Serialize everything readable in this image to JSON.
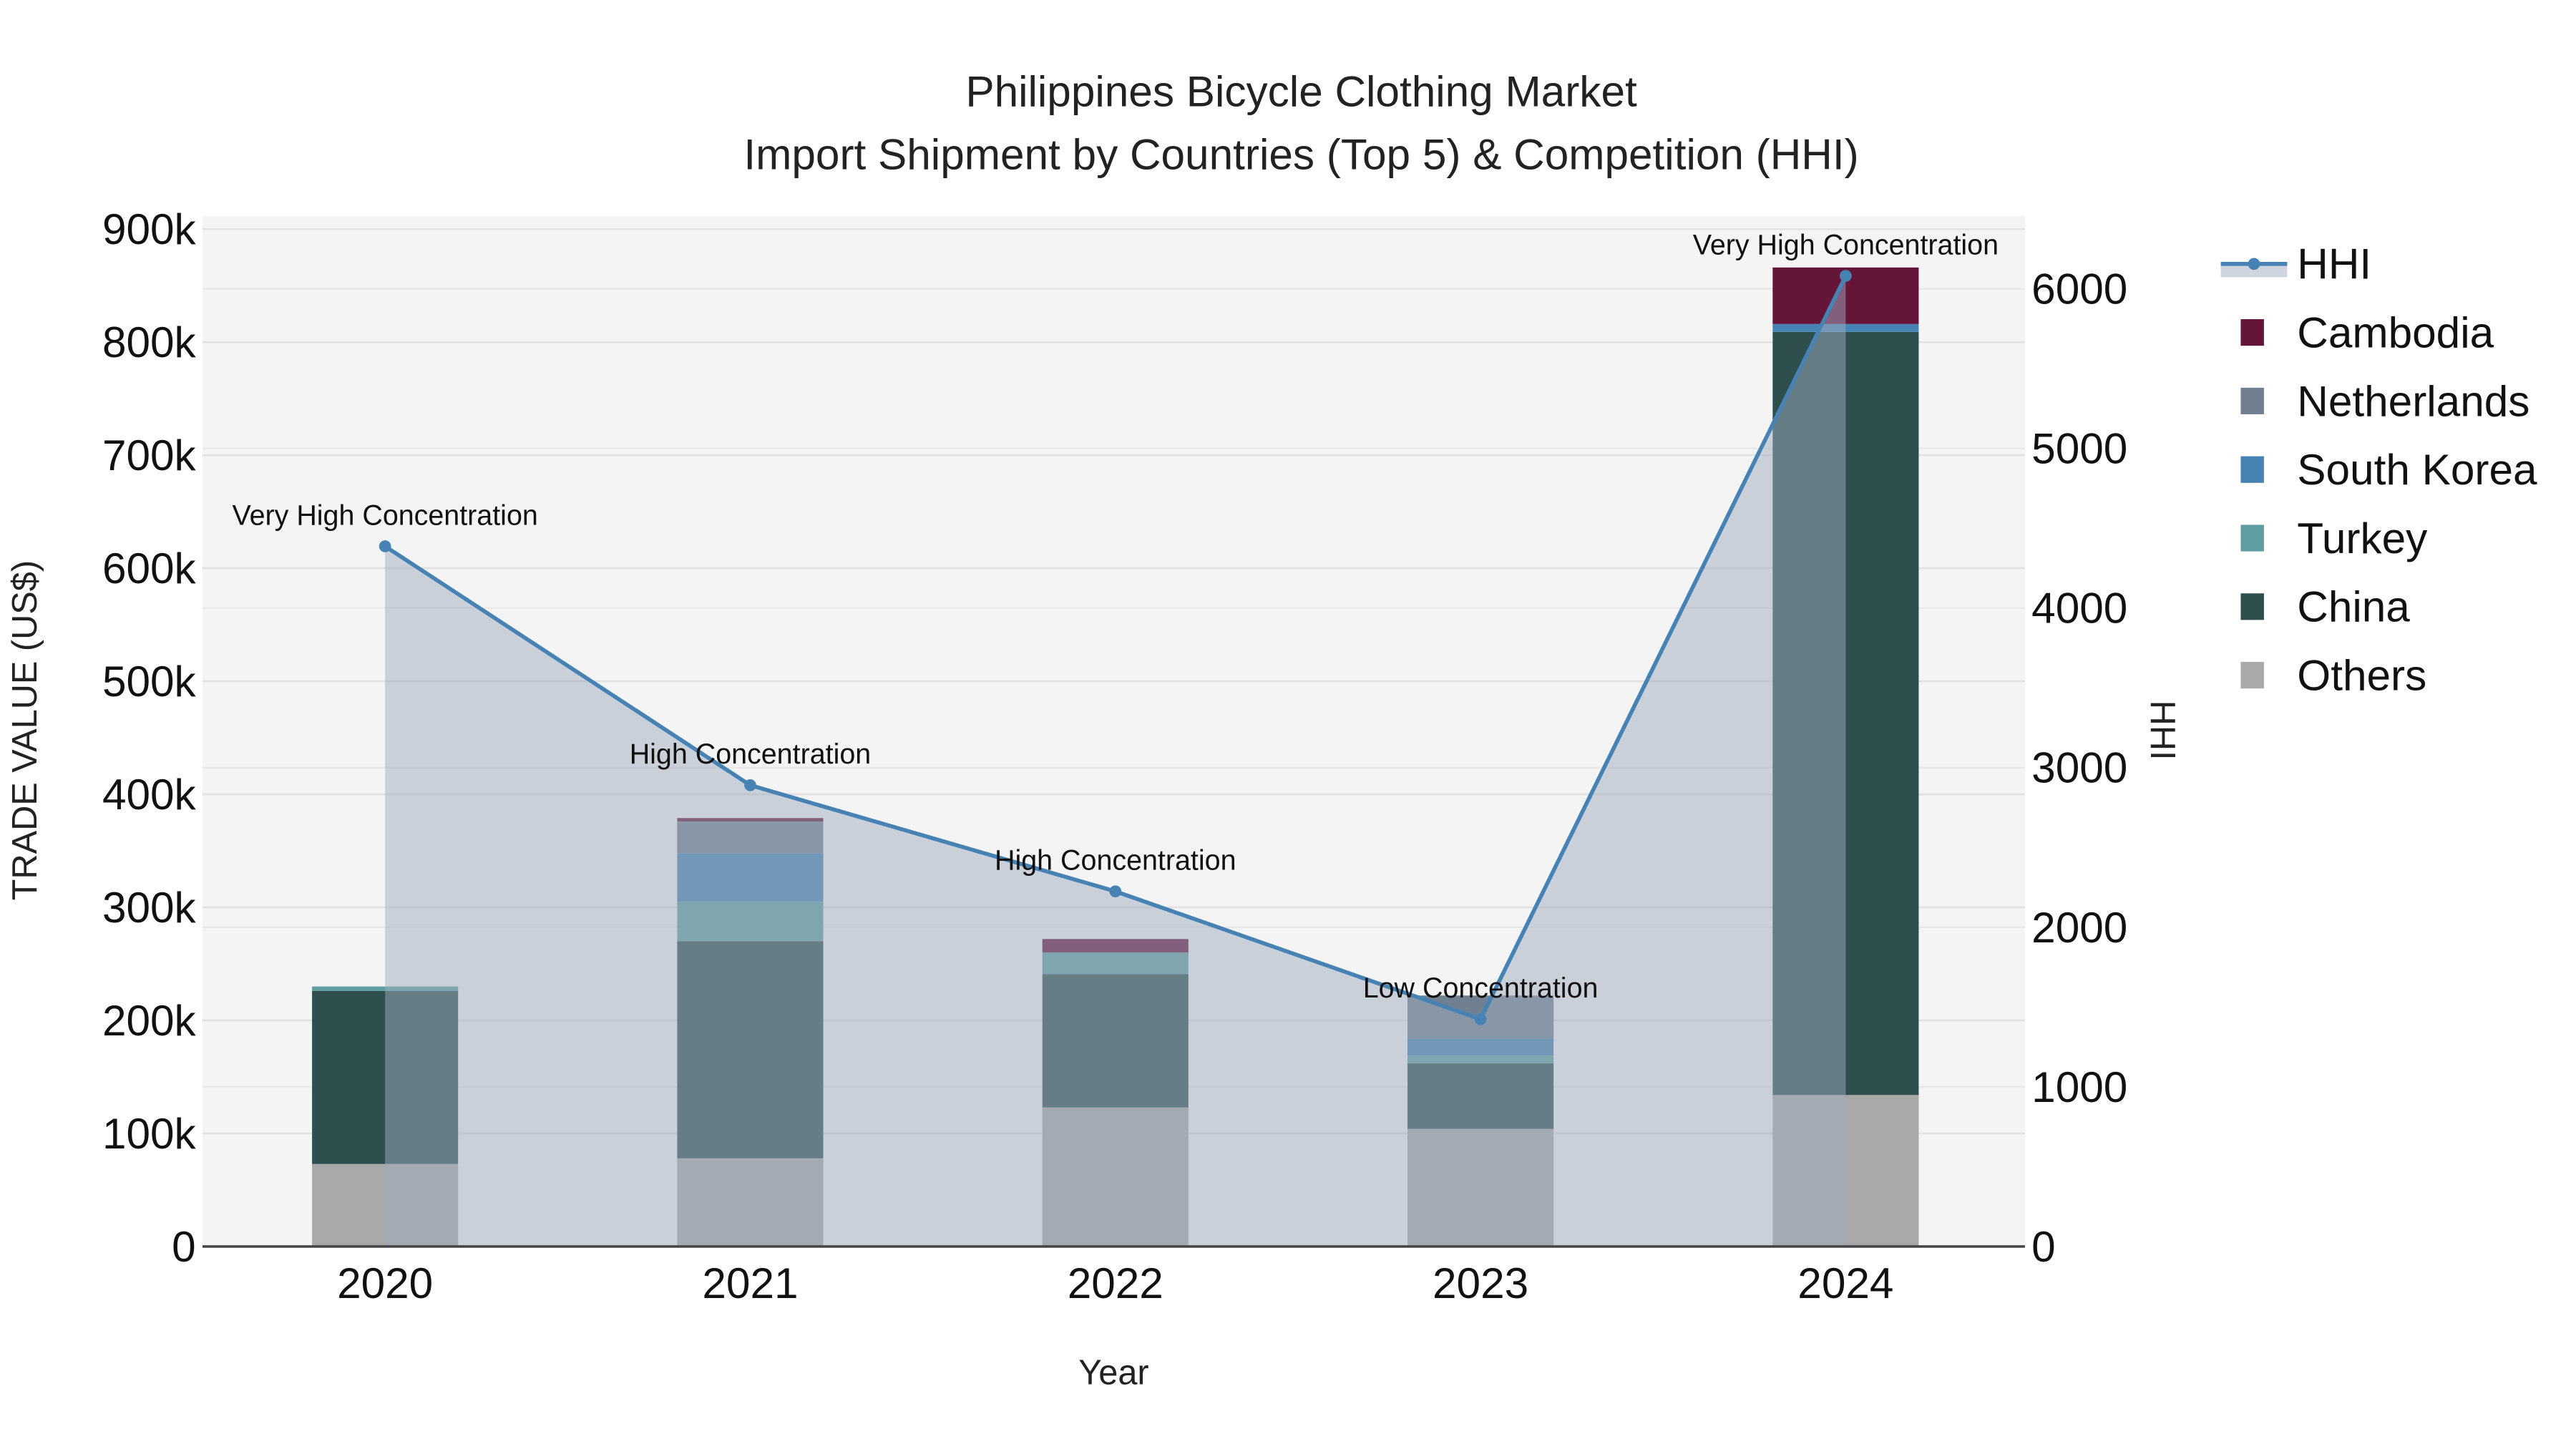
{
  "chart_data": {
    "type": "bar",
    "title": "Philippines Bicycle Clothing Market",
    "subtitle": "Import Shipment by Countries (Top 5) & Competition (HHI)",
    "xlabel": "Year",
    "ylabel": "TRADE VALUE (US$)",
    "y2label": "HHI",
    "categories": [
      "2020",
      "2021",
      "2022",
      "2023",
      "2024"
    ],
    "ylim": [
      0,
      900000
    ],
    "y_ticks": [
      0,
      100000,
      200000,
      300000,
      400000,
      500000,
      600000,
      700000,
      800000,
      900000
    ],
    "y_tick_labels": [
      "0",
      "100k",
      "200k",
      "300k",
      "400k",
      "500k",
      "600k",
      "700k",
      "800k",
      "900k"
    ],
    "y2lim": [
      0,
      6400
    ],
    "y2_ticks": [
      0,
      1000,
      2000,
      3000,
      4000,
      5000,
      6000
    ],
    "y2_tick_labels": [
      "0",
      "1000",
      "2000",
      "3000",
      "4000",
      "5000",
      "6000"
    ],
    "grid": true,
    "legend_placement": "right",
    "series": [
      {
        "name": "Others",
        "color": "#a9a9a9",
        "values": [
          73000,
          78000,
          123000,
          104000,
          134000
        ]
      },
      {
        "name": "China",
        "color": "#2f4f4f",
        "values": [
          153000,
          192000,
          118000,
          58000,
          675000
        ]
      },
      {
        "name": "Turkey",
        "color": "#5f9ea0",
        "values": [
          4000,
          35000,
          19000,
          7000,
          0
        ]
      },
      {
        "name": "South Korea",
        "color": "#4682b4",
        "values": [
          0,
          43000,
          0,
          15000,
          7000
        ]
      },
      {
        "name": "Netherlands",
        "color": "#708090",
        "values": [
          0,
          28000,
          0,
          38000,
          0
        ]
      },
      {
        "name": "Cambodia",
        "color": "#641538",
        "values": [
          0,
          3000,
          12000,
          0,
          50000
        ]
      }
    ],
    "hhi": {
      "name": "HHI",
      "color": "#4682b4",
      "values": [
        4387,
        2890,
        2225,
        1424,
        6081
      ],
      "annotations": [
        "Very High Concentration",
        "High Concentration",
        "High Concentration",
        "Low Concentration",
        "Very High Concentration"
      ]
    },
    "legend_order": [
      "HHI",
      "Cambodia",
      "Netherlands",
      "South Korea",
      "Turkey",
      "China",
      "Others"
    ]
  }
}
